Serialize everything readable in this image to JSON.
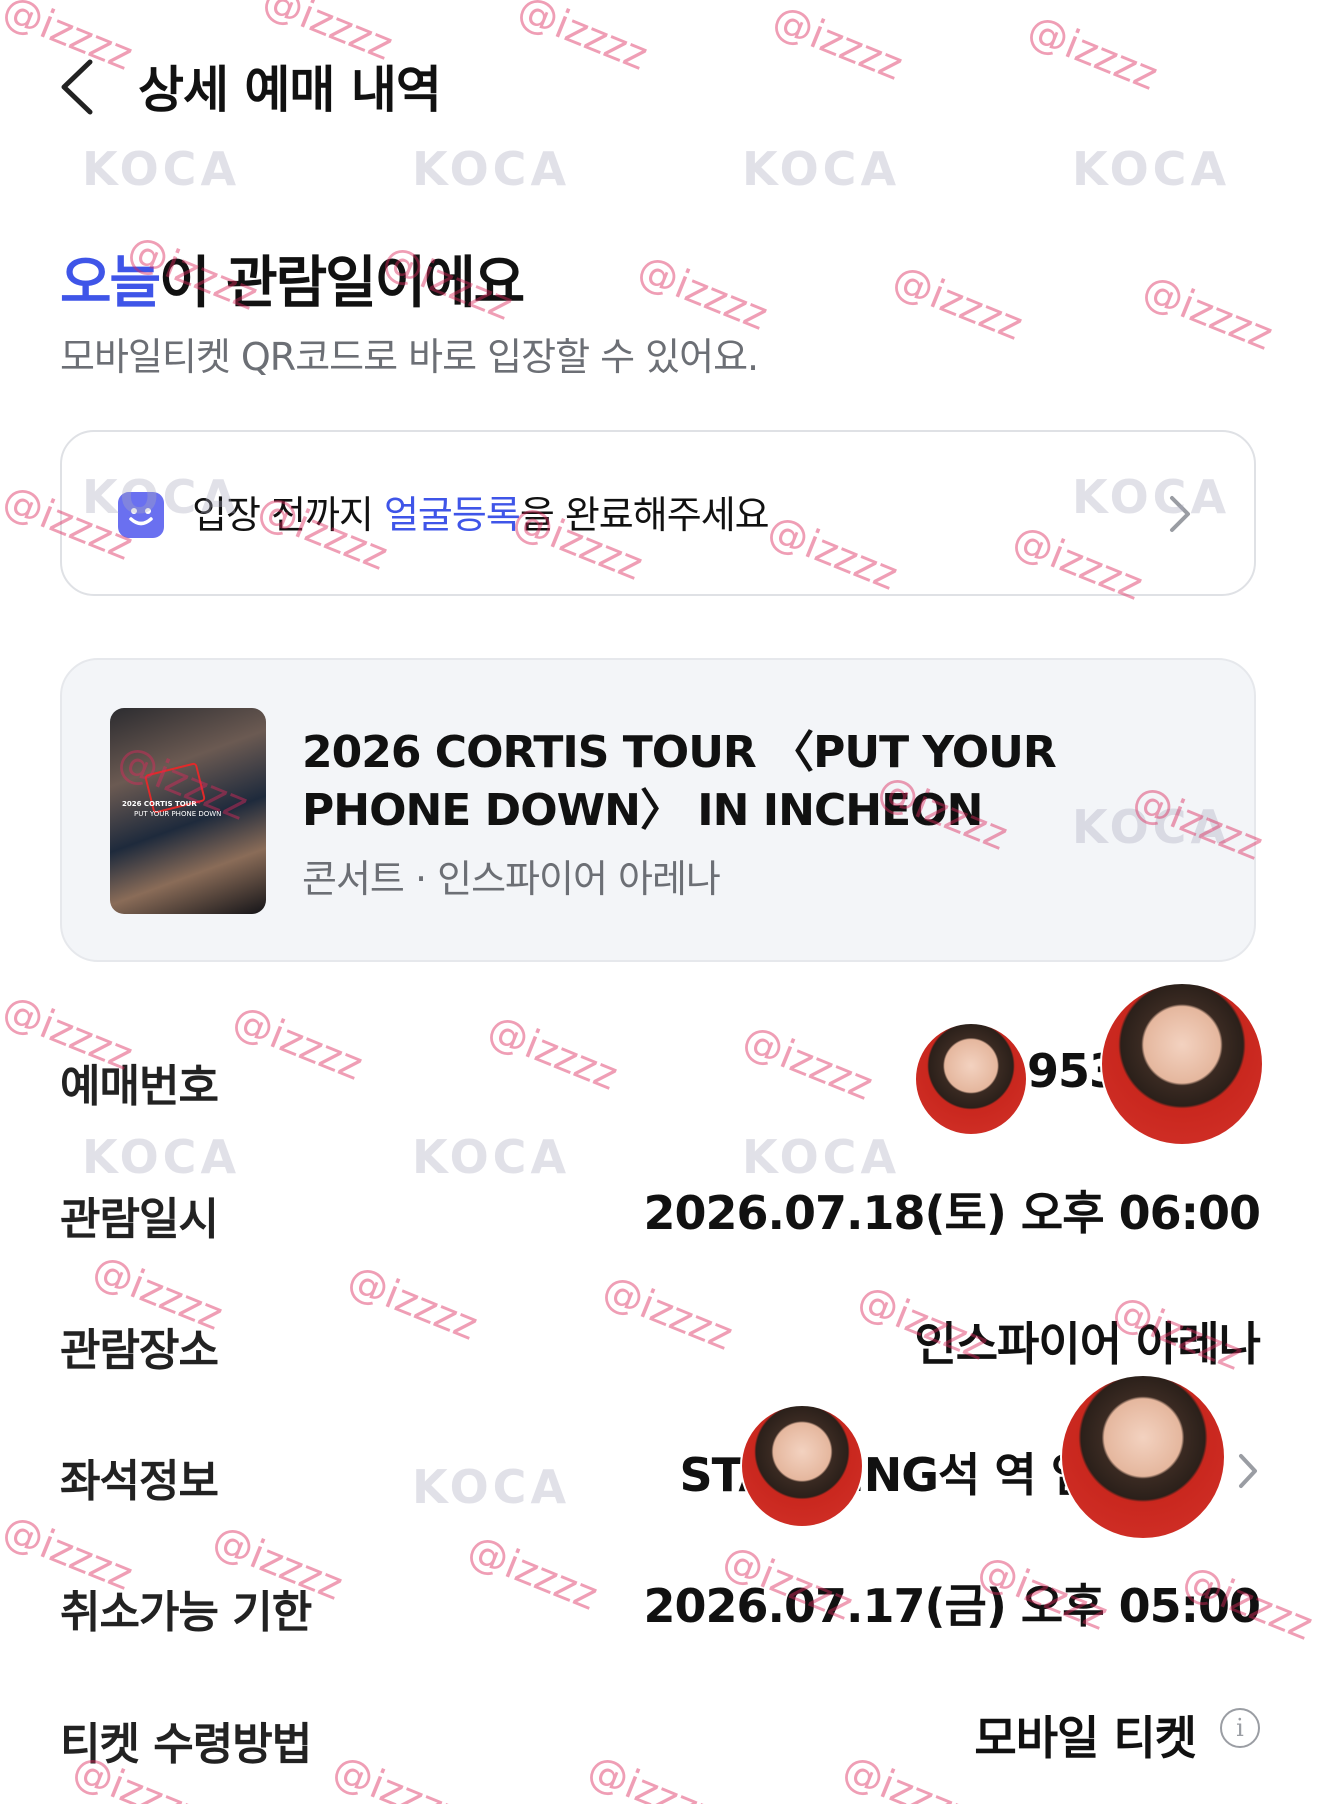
{
  "header": {
    "title": "상세 예매 내역"
  },
  "hero": {
    "title_accent": "오늘",
    "title_rest": "이 관람일이에요",
    "subtitle": "모바일티켓 QR코드로 바로 입장할 수 있어요."
  },
  "face_banner": {
    "text_before": "입장 전까지 ",
    "text_accent": "얼굴등록",
    "text_after": "을 완료해주세요",
    "icon": "face-register-icon"
  },
  "event": {
    "title": "2026 CORTIS TOUR 〈PUT YOUR PHONE DOWN〉 IN INCHEON",
    "meta": "콘서트 · 인스파이어 아레나",
    "poster_text1": "2026 CORTIS TOUR",
    "poster_text2": "PUT YOUR PHONE DOWN"
  },
  "details": {
    "reservation_label": "예매번호",
    "reservation_value": "953",
    "date_label": "관람일시",
    "date_value": "2026.07.18(토) 오후 06:00",
    "venue_label": "관람장소",
    "venue_value": "인스파이어 아레나",
    "seat_label": "좌석정보",
    "seat_value": "STANDING석  역 입장번호",
    "cancel_label": "취소가능 기한",
    "cancel_value": "2026.07.17(금) 오후 05:00",
    "delivery_label": "티켓 수령방법",
    "delivery_value": "모바일 티켓",
    "info_icon_glyph": "i"
  },
  "watermark": {
    "handle": "@izzzz",
    "logo": "KOCA"
  },
  "colors": {
    "accent": "#3f55e8",
    "face_icon": "#6a70f0",
    "muted_text": "#6c6f75",
    "card_bg": "#f3f5f8"
  }
}
